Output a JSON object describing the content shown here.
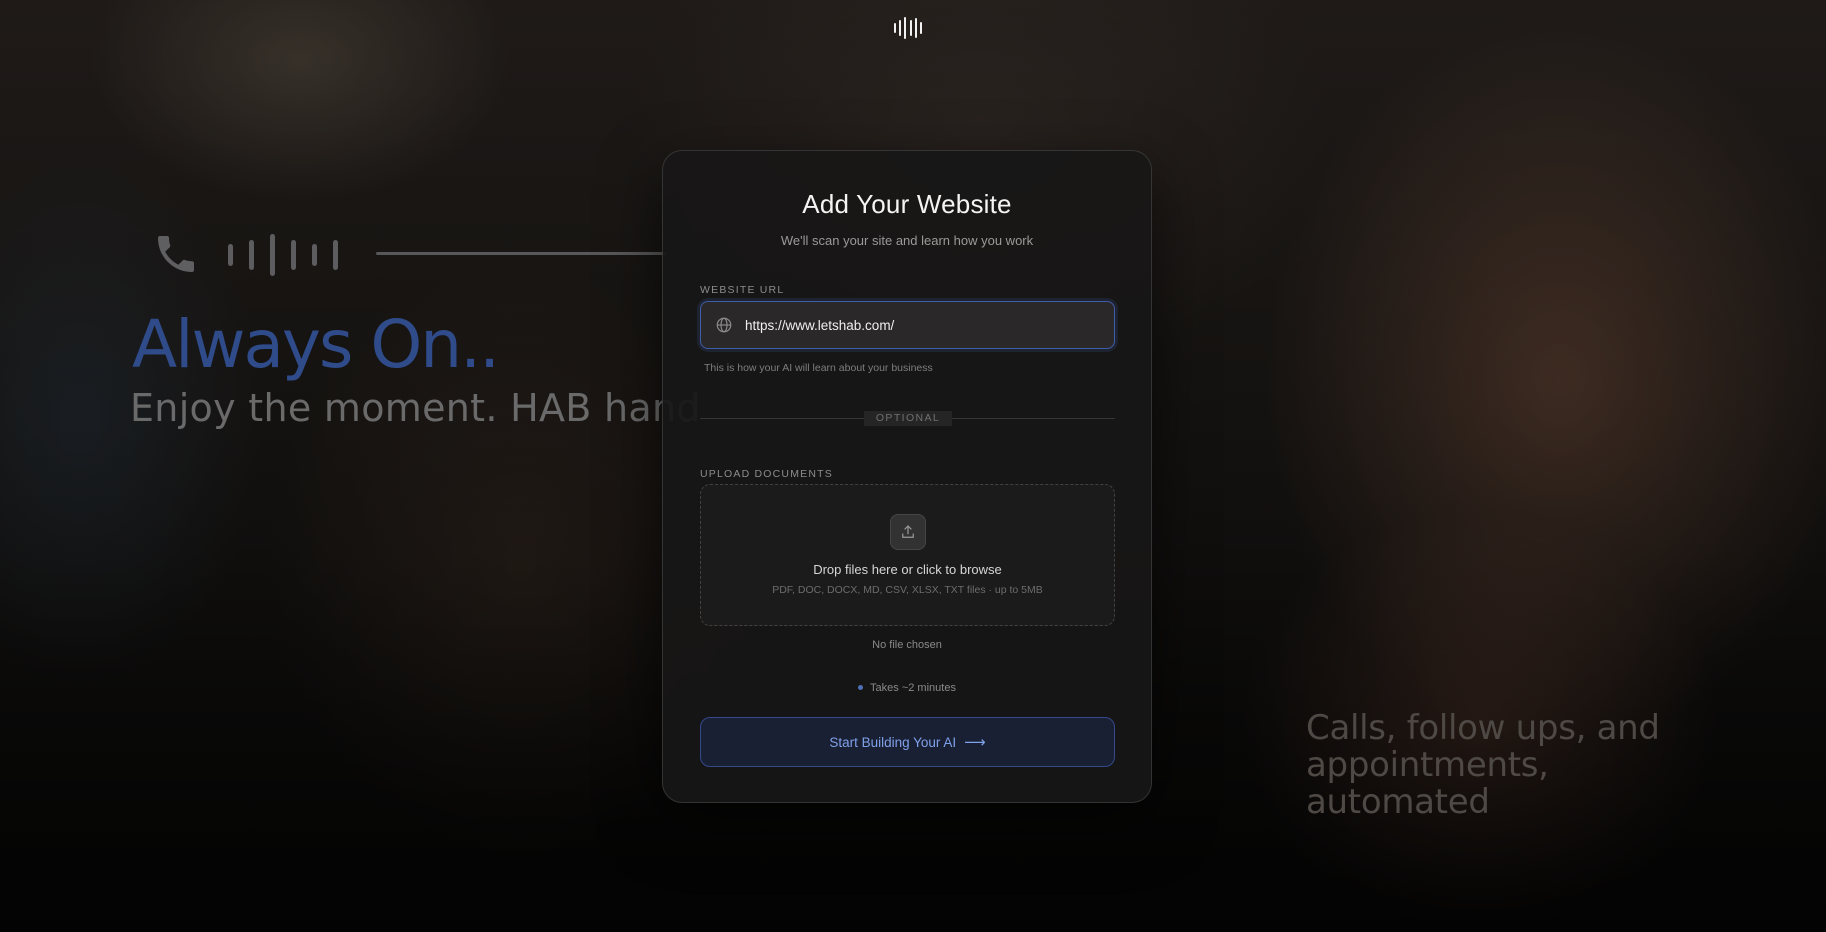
{
  "hero": {
    "title": "Always On..",
    "subtitle": "Enjoy the moment. HAB hand",
    "right_text": "Calls, follow ups, and appointments, automated"
  },
  "card": {
    "title": "Add Your Website",
    "subtitle": "We'll scan your site and learn how you work",
    "website_label": "WEBSITE URL",
    "website_value": "https://www.letshab.com/",
    "website_hint": "This is how your AI will learn about your business",
    "optional_label": "OPTIONAL",
    "upload_label": "UPLOAD DOCUMENTS",
    "drop_text": "Drop files here or click to browse",
    "drop_types": "PDF, DOC, DOCX, MD, CSV, XLSX, TXT files · up to 5MB",
    "no_file": "No file chosen",
    "eta": "Takes ~2 minutes",
    "cta_label": "Start Building Your AI",
    "cta_arrow": "⟶"
  },
  "icons": {
    "logo": "waveform-logo-icon",
    "phone": "phone-icon",
    "sound": "soundwave-icon",
    "globe": "globe-icon",
    "upload": "upload-icon"
  },
  "colors": {
    "accent": "#4f6fb6",
    "hero_title": "#2f4b8a",
    "cta_text": "#7fa0ea",
    "input_border": "#3f5da8"
  }
}
